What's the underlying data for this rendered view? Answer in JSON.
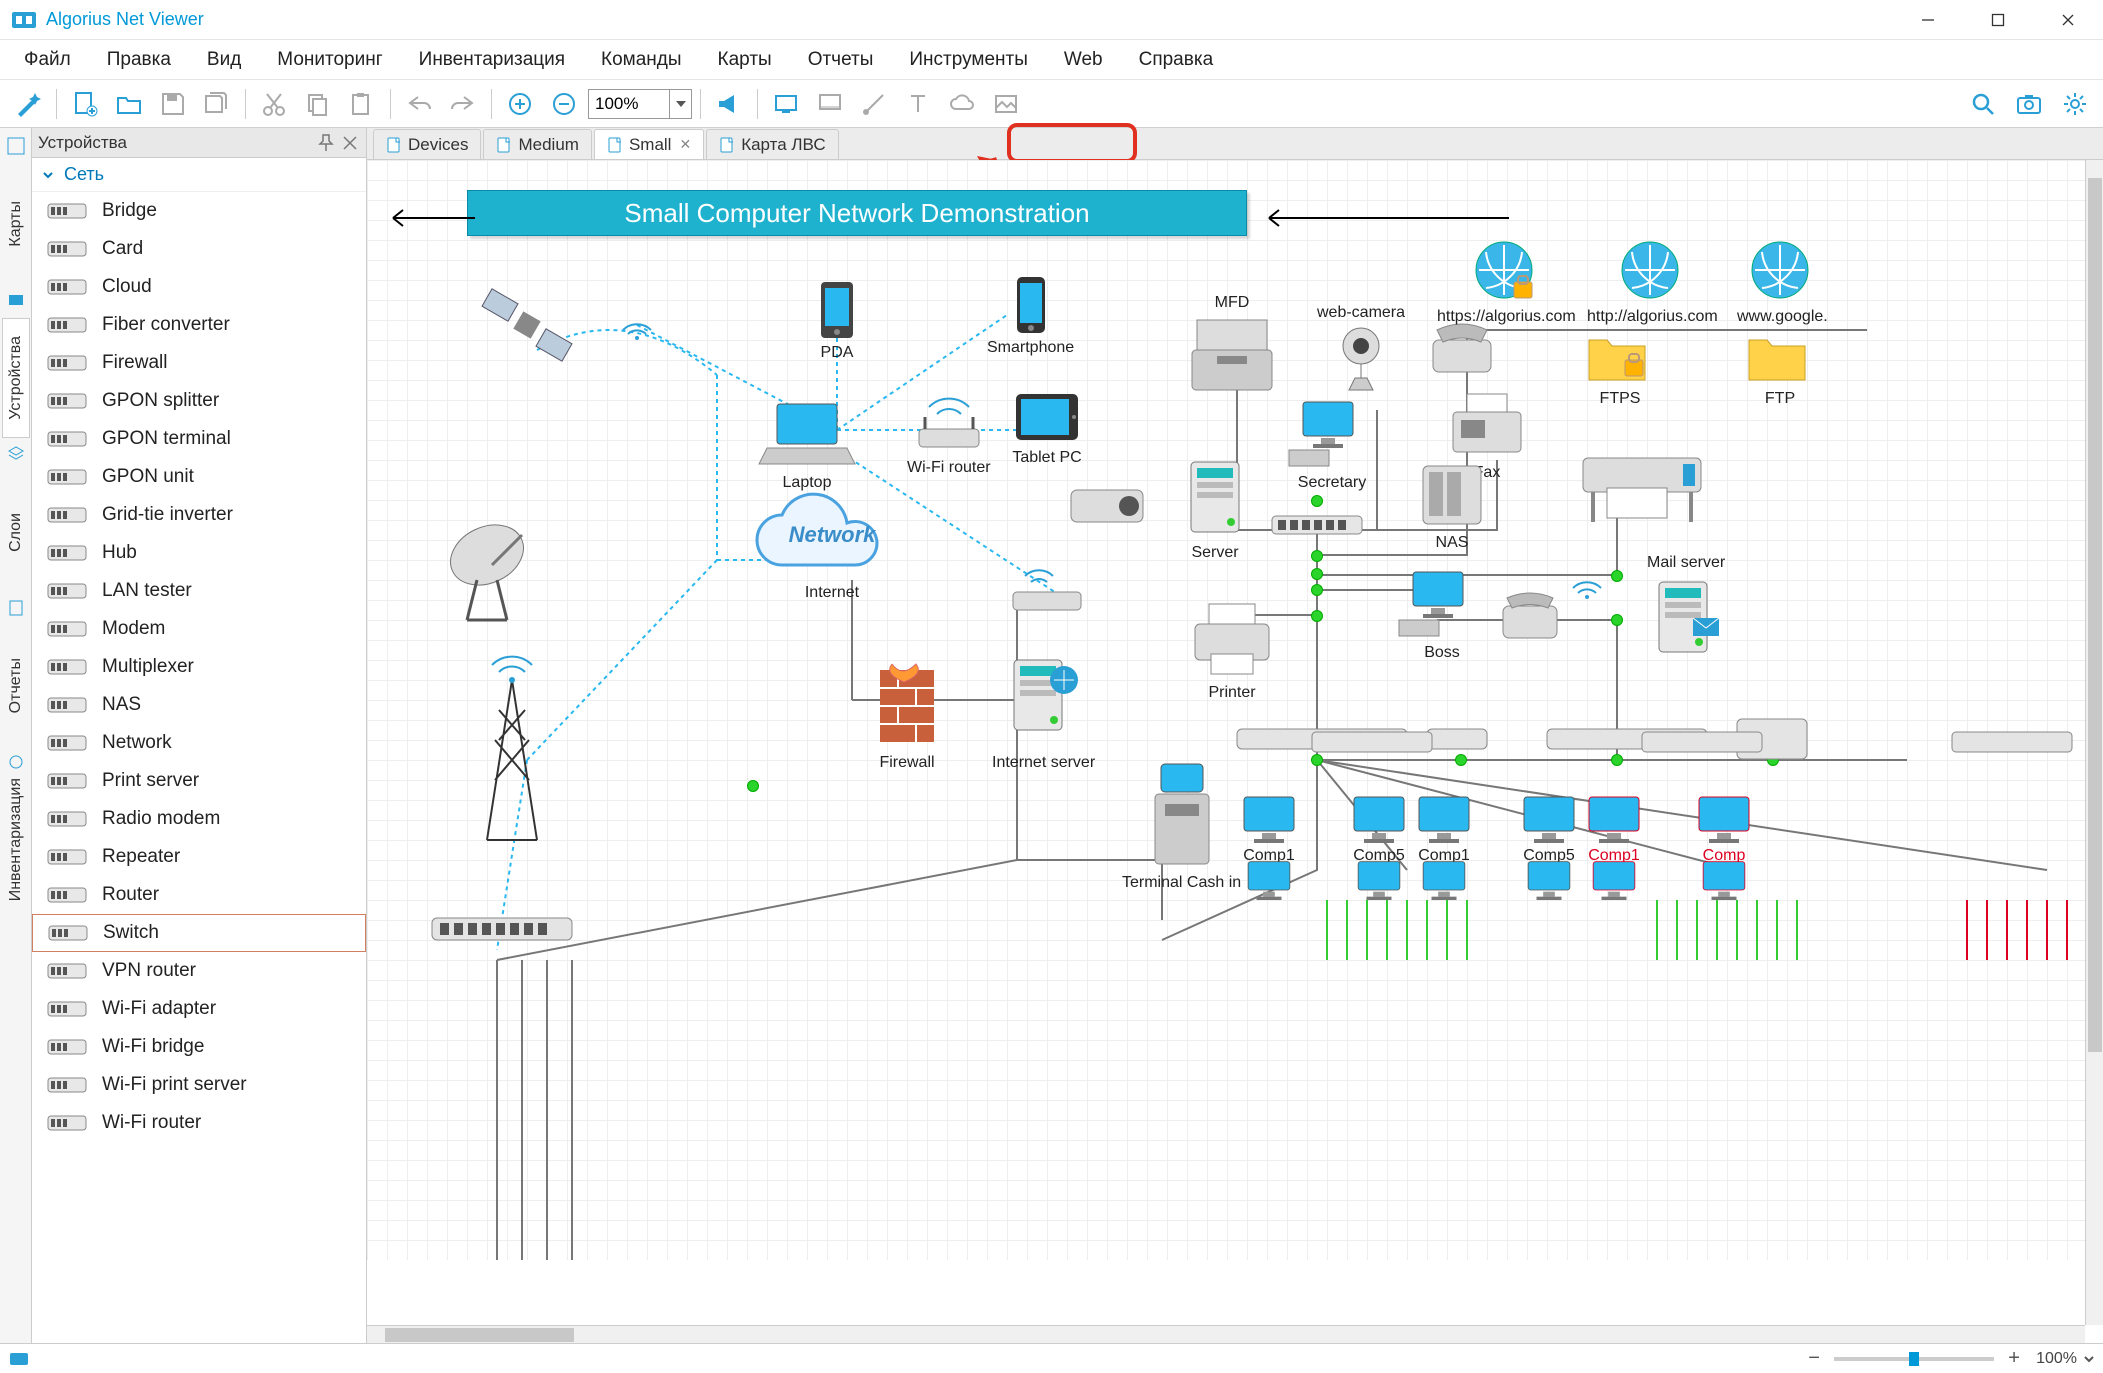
{
  "app": {
    "title": "Algorius Net Viewer"
  },
  "menubar": [
    "Файл",
    "Правка",
    "Вид",
    "Мониторинг",
    "Инвентаризация",
    "Команды",
    "Карты",
    "Отчеты",
    "Инструменты",
    "Web",
    "Справка"
  ],
  "toolbar": {
    "zoom_value": "100%"
  },
  "side_panel": {
    "title": "Устройства",
    "group": "Сеть",
    "items": [
      "Bridge",
      "Card",
      "Cloud",
      "Fiber converter",
      "Firewall",
      "GPON splitter",
      "GPON terminal",
      "GPON unit",
      "Grid-tie inverter",
      "Hub",
      "LAN tester",
      "Modem",
      "Multiplexer",
      "NAS",
      "Network",
      "Print server",
      "Radio modem",
      "Repeater",
      "Router",
      "Switch",
      "VPN router",
      "Wi-Fi adapter",
      "Wi-Fi bridge",
      "Wi-Fi print server",
      "Wi-Fi router"
    ],
    "selected_index": 19
  },
  "side_tabs": [
    "Карты",
    "Устройства",
    "Слои",
    "Отчеты",
    "Инвентаризация"
  ],
  "doc_tabs": [
    {
      "label": "Devices",
      "active": false
    },
    {
      "label": "Medium",
      "active": false
    },
    {
      "label": "Small",
      "active": true
    },
    {
      "label": "Карта ЛВС",
      "active": false
    }
  ],
  "canvas": {
    "banner": "Small Computer Network Demonstration",
    "nodes": {
      "pda": "PDA",
      "smartphone": "Smartphone",
      "mfd": "MFD",
      "webcam": "web-camera",
      "laptop": "Laptop",
      "wifi": "Wi-Fi router",
      "tablet": "Tablet PC",
      "secretary": "Secretary",
      "fax": "Fax",
      "ftps": "FTPS",
      "ftp": "FTP",
      "algs": "https://algorius.com",
      "alg": "http://algorius.com",
      "google": "www.google.",
      "server": "Server",
      "nas": "NAS",
      "mailserver": "Mail server",
      "boss": "Boss",
      "internet": "Internet",
      "network_cloud": "Network",
      "firewall": "Firewall",
      "inetserver": "Internet server",
      "printer": "Printer",
      "terminal": "Terminal Cash in",
      "comp1a": "Comp1",
      "comp5a": "Comp5",
      "comp1b": "Comp1",
      "comp5b": "Comp5",
      "comp1r": "Comp1",
      "compr2": "Comp"
    }
  },
  "statusbar": {
    "zoom": "100%"
  }
}
